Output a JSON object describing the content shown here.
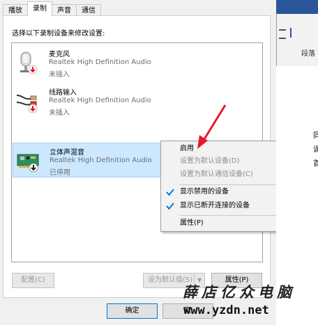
{
  "tabs": [
    "播放",
    "录制",
    "声音",
    "通信"
  ],
  "active_tab": 1,
  "prompt": "选择以下录制设备来修改设置:",
  "devices": [
    {
      "name": "麦克风",
      "driver": "Realtek High Definition Audio",
      "status": "未插入",
      "icon": "microphone-icon"
    },
    {
      "name": "线路输入",
      "driver": "Realtek High Definition Audio",
      "status": "未插入",
      "icon": "line-in-cable-icon"
    },
    {
      "name": "立体声混音",
      "driver": "Realtek High Definition Audio",
      "status": "已停用",
      "icon": "sound-card-icon"
    }
  ],
  "buttons": {
    "configure": "配置(C)",
    "set_default": "设为默认值(S)",
    "properties": "属性(P)",
    "ok": "确定",
    "cancel": "取"
  },
  "context_menu": {
    "enable": "启用",
    "set_default_device": "设置为默认设备(D)",
    "set_default_comm": "设置为默认通信设备(C)",
    "show_disabled": "显示禁用的设备",
    "show_disconnected": "显示已断开连接的设备",
    "properties": "属性(P)"
  },
  "background_window": {
    "ribbon_group": "段落",
    "doc_chars": [
      "同",
      "课",
      "首"
    ]
  },
  "watermark": {
    "title": "薛店亿众电脑",
    "url": "www.yzdn.net"
  },
  "colors": {
    "selection": "#cce8ff",
    "status_arrow": "#e81123",
    "check": "#0078d7",
    "annotation_arrow": "#e8192c"
  }
}
